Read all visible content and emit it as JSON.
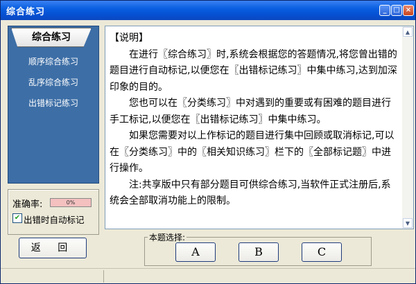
{
  "window": {
    "title": "综合练习",
    "min": "_",
    "max": "□",
    "close": "×"
  },
  "left_panel": {
    "active_tab": "综合练习",
    "items": [
      "顺序综合练习",
      "乱序综合练习",
      "出错标记练习"
    ]
  },
  "accuracy": {
    "label": "准确率:",
    "value": "0%",
    "fraction": 0
  },
  "auto_mark": {
    "checked": true,
    "label": "出错时自动标记"
  },
  "back_button": "返 回",
  "content": {
    "paragraphs": [
      "【说明】",
      "在进行〖综合练习〗时,系统会根据您的答题情况,将您曾出错的题目进行自动标记,以便您在〖出错标记练习〗中集中练习,达到加深印象的目的。",
      "您也可以在〖分类练习〗中对遇到的重要或有困难的题目进行手工标记,以便您在〖出错标记练习〗中集中练习。",
      "如果您需要对以上作标记的题目进行集中回顾或取消标记,可以在〖分类练习〗中的〖相关知识练习〗栏下的〖全部标记题〗中进行操作。",
      "注:共享版中只有部分题目可供综合练习,当软件正式注册后,系统会全部取消功能上的限制。"
    ]
  },
  "answer_select": {
    "label": "本题选择:",
    "options": [
      "A",
      "B",
      "C"
    ]
  },
  "colors": {
    "title_bar": "#0551d4",
    "panel": "#3d6ea6",
    "progress": "#f4c0c0"
  }
}
